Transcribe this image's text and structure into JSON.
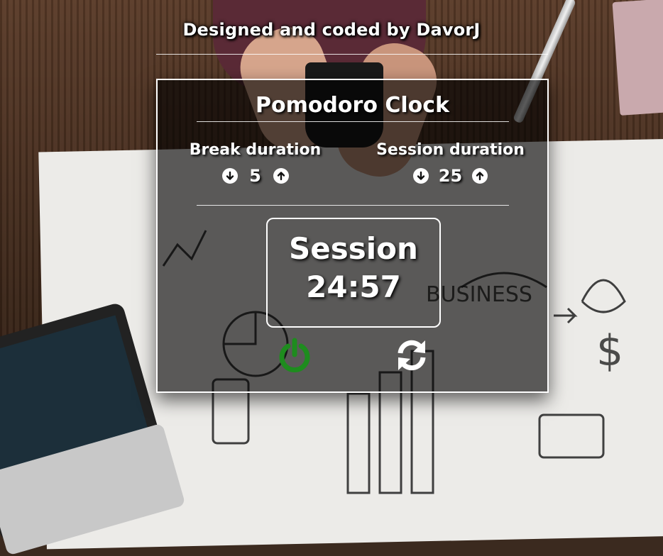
{
  "header": {
    "credit": "Designed and coded by DavorJ"
  },
  "app": {
    "title": "Pomodoro Clock"
  },
  "break": {
    "label": "Break duration",
    "value": "5",
    "decrement_icon": "arrow-circle-down-icon",
    "increment_icon": "arrow-circle-up-icon"
  },
  "session": {
    "label": "Session duration",
    "value": "25",
    "decrement_icon": "arrow-circle-down-icon",
    "increment_icon": "arrow-circle-up-icon"
  },
  "timer": {
    "mode": "Session",
    "time": "24:57"
  },
  "controls": {
    "power_icon": "power-icon",
    "reset_icon": "refresh-icon"
  },
  "colors": {
    "power": "#1e8c1e",
    "text": "#ffffff"
  }
}
